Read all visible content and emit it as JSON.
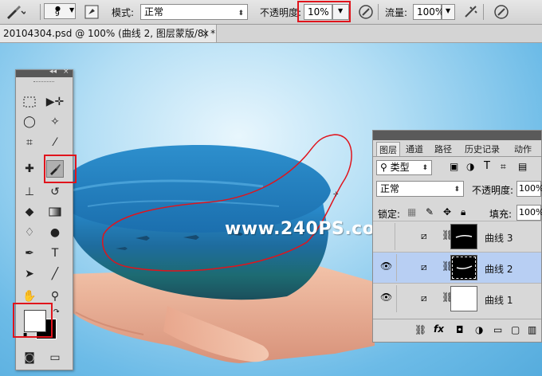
{
  "options_bar": {
    "brush_size": "9",
    "mode_label": "模式:",
    "mode_value": "正常",
    "opacity_label": "不透明度:",
    "opacity_value": "10%",
    "flow_label": "流量:",
    "flow_value": "100%"
  },
  "document_tab": {
    "title": "20104304.psd @ 100% (曲线 2, 图层蒙版/8) *",
    "close": "×"
  },
  "watermark": "www.240PS.com",
  "layers_panel": {
    "tabs": [
      "图层",
      "通道",
      "路径",
      "历史记录",
      "动作"
    ],
    "filter_label": "类型",
    "blend_mode": "正常",
    "opacity_label": "不透明度:",
    "opacity_value": "100%",
    "lock_label": "锁定:",
    "fill_label": "填充:",
    "fill_value": "100%",
    "layers": [
      {
        "name": "曲线 3",
        "selected": false,
        "visible": false
      },
      {
        "name": "曲线 2",
        "selected": true,
        "visible": true
      },
      {
        "name": "曲线 1",
        "selected": false,
        "visible": true
      }
    ],
    "footer_fx": "fx"
  },
  "colors": {
    "highlight_red": "#e0141c",
    "selected_layer": "#b8cff3",
    "panel_bg": "#d6d6d6"
  }
}
